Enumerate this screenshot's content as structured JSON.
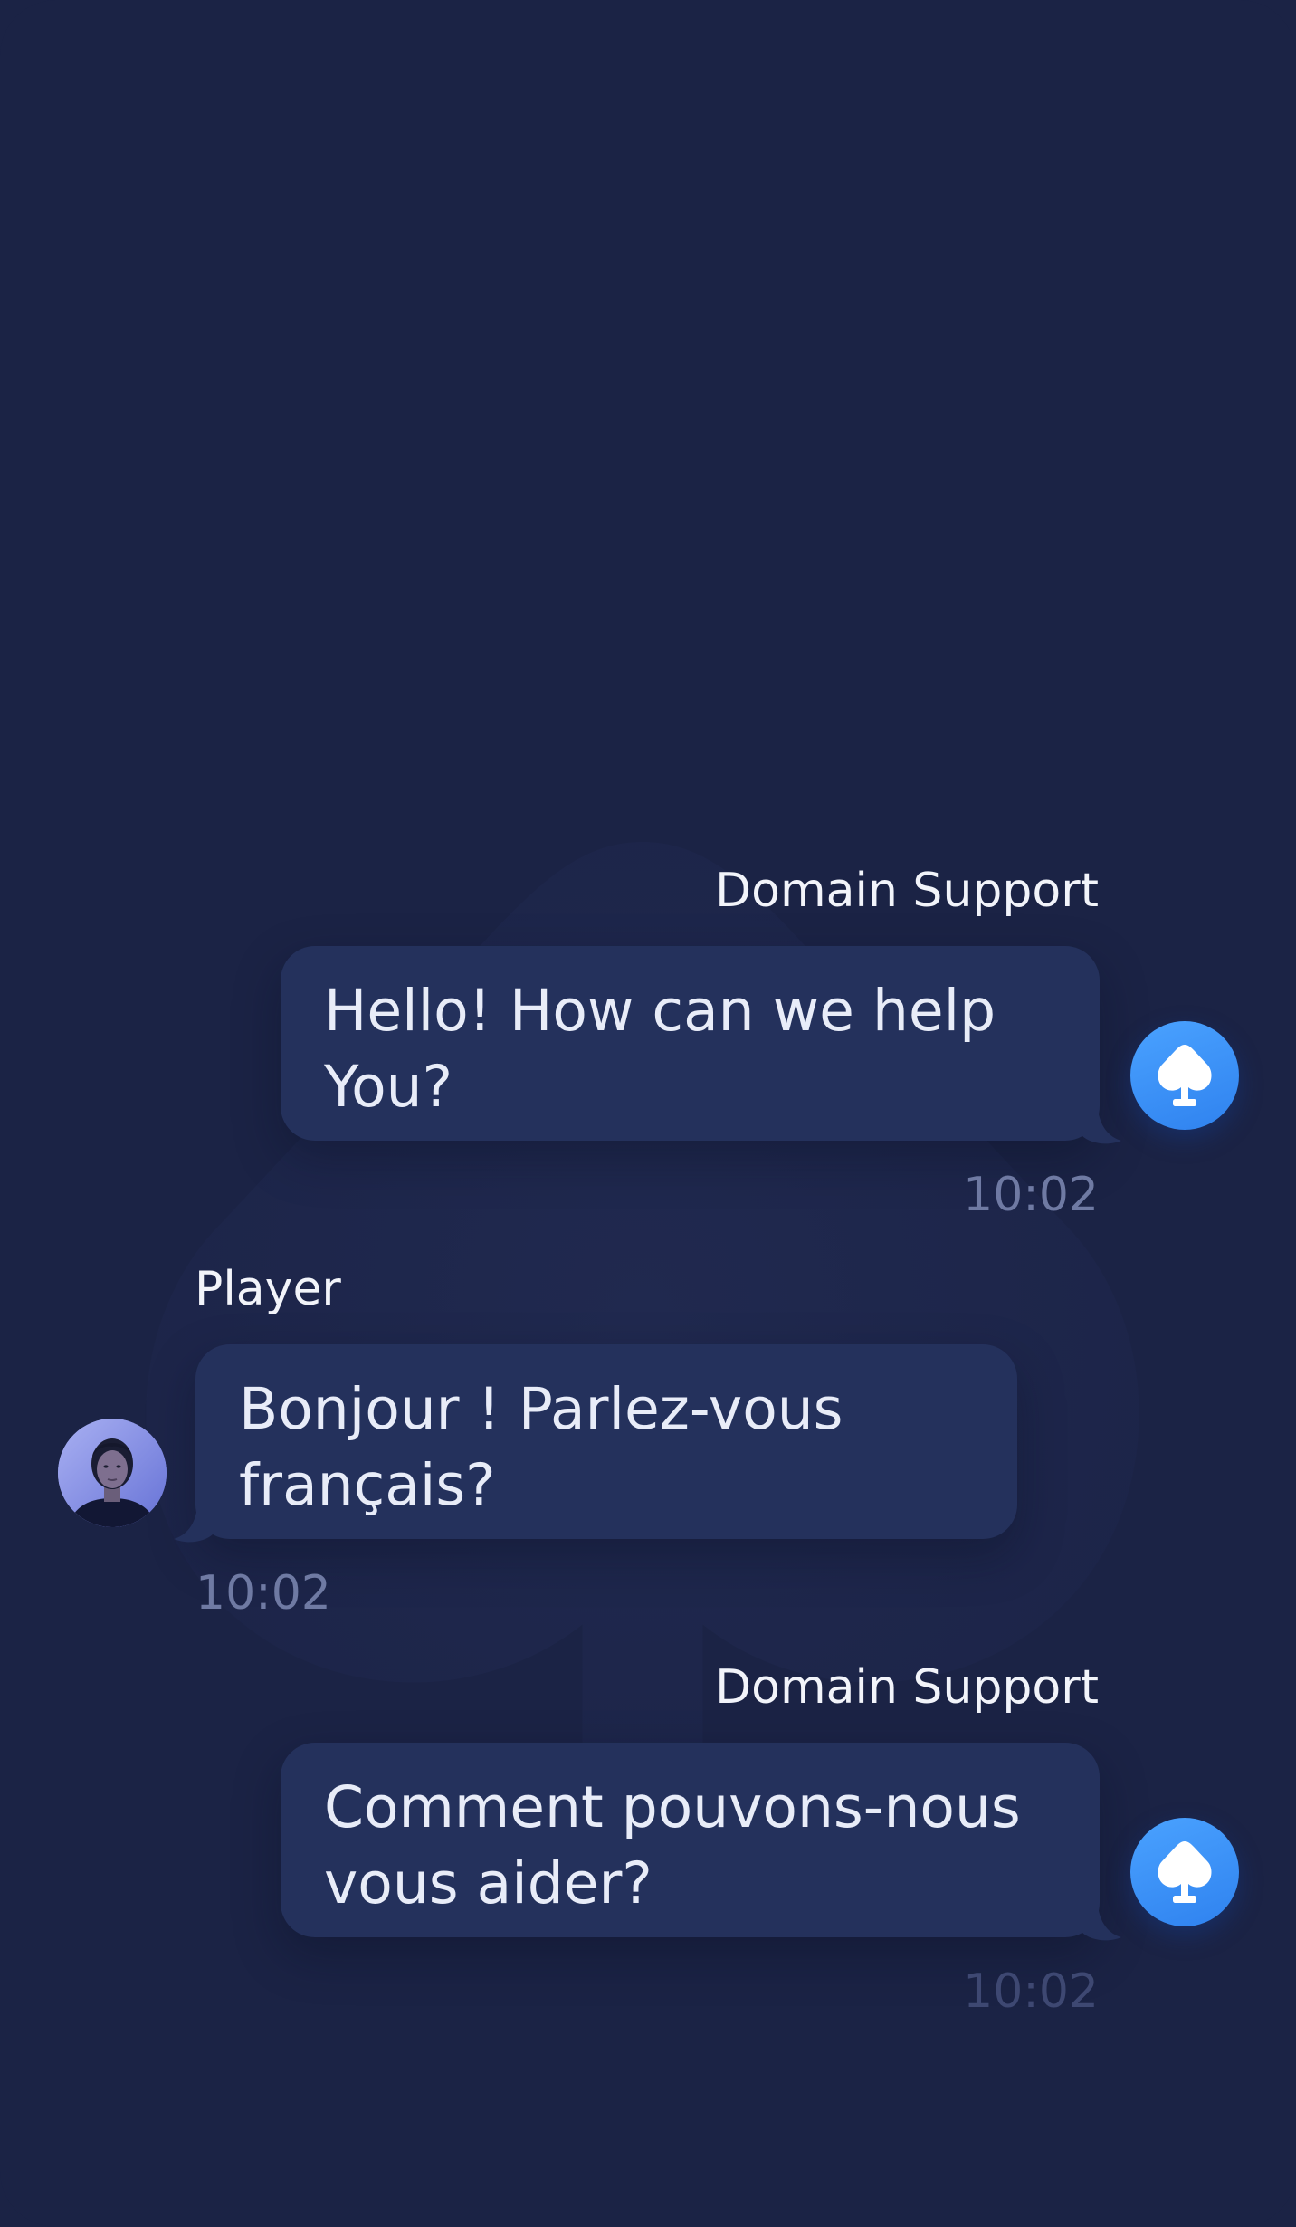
{
  "colors": {
    "background": "#1b2345",
    "bubble": "#24315c",
    "accent": "#3b8ff6",
    "time_text": "#6f7aa3"
  },
  "messages": [
    {
      "side": "support",
      "sender": "Domain Support",
      "text": "Hello! How can we help You?",
      "time": "10:02",
      "avatar_icon": "spade-icon"
    },
    {
      "side": "player",
      "sender": "Player",
      "text": "Bonjour ! Parlez-vous français?",
      "time": "10:02",
      "avatar_icon": "user-photo"
    },
    {
      "side": "support",
      "sender": "Domain Support",
      "text": "Comment pouvons-nous vous aider?",
      "time": "10:02",
      "avatar_icon": "spade-icon"
    }
  ]
}
